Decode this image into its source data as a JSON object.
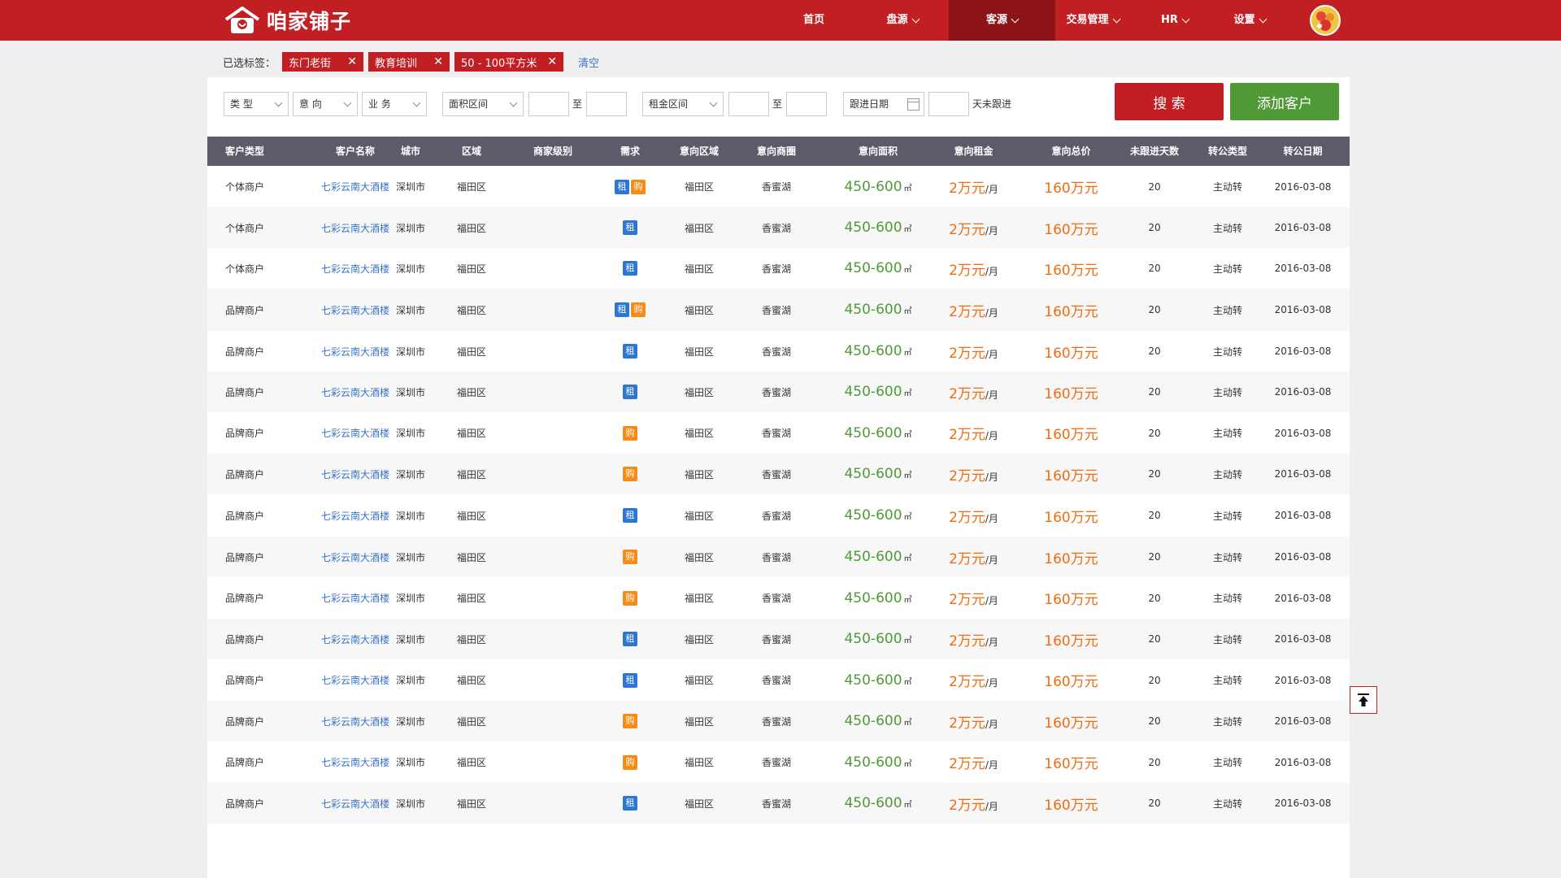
{
  "brand": {
    "name": "咱家铺子"
  },
  "nav": {
    "items": [
      {
        "label": "首页",
        "dropdown": false,
        "active": false
      },
      {
        "label": "盘源",
        "dropdown": true,
        "active": false
      },
      {
        "label": "客源",
        "dropdown": true,
        "active": true
      },
      {
        "label": "交易管理",
        "dropdown": true,
        "active": false
      },
      {
        "label": "HR",
        "dropdown": true,
        "active": false
      },
      {
        "label": "设置",
        "dropdown": true,
        "active": false
      }
    ]
  },
  "tags": {
    "label": "已选标签：",
    "items": [
      "东门老街",
      "教育培训",
      "50 - 100平方米"
    ],
    "clear_label": "清空"
  },
  "filters": {
    "type": "类 型",
    "intent": "意 向",
    "business": "业 务",
    "area_range": "面积区间",
    "to1": "至",
    "rent_range": "租金区间",
    "to2": "至",
    "follow_date": "跟进日期",
    "days_unfollowed": "天未跟进",
    "search_label": "搜 索",
    "add_label": "添加客户"
  },
  "table": {
    "columns": [
      "客户类型",
      "客户名称",
      "城市",
      "区域",
      "商家级别",
      "需求",
      "意向区域",
      "意向商圈",
      "意向面积",
      "意向租金",
      "意向总价",
      "未跟进天数",
      "转公类型",
      "转公日期"
    ],
    "badge_labels": {
      "rent": "租",
      "buy": "购"
    },
    "rows": [
      {
        "type": "个体商户",
        "name": "七彩云南大酒楼",
        "city": "深圳市",
        "district": "福田区",
        "level": "",
        "needs": [
          "rent",
          "buy"
        ],
        "area_intent": "福田区",
        "circle": "香蜜湖",
        "area": "450-600",
        "area_unit": "㎡",
        "rent": "2万元",
        "rent_unit": "/月",
        "price": "160万元",
        "days": "20",
        "transfer_type": "主动转",
        "transfer_date": "2016-03-08"
      },
      {
        "type": "个体商户",
        "name": "七彩云南大酒楼",
        "city": "深圳市",
        "district": "福田区",
        "level": "",
        "needs": [
          "rent"
        ],
        "area_intent": "福田区",
        "circle": "香蜜湖",
        "area": "450-600",
        "area_unit": "㎡",
        "rent": "2万元",
        "rent_unit": "/月",
        "price": "160万元",
        "days": "20",
        "transfer_type": "主动转",
        "transfer_date": "2016-03-08"
      },
      {
        "type": "个体商户",
        "name": "七彩云南大酒楼",
        "city": "深圳市",
        "district": "福田区",
        "level": "",
        "needs": [
          "rent"
        ],
        "area_intent": "福田区",
        "circle": "香蜜湖",
        "area": "450-600",
        "area_unit": "㎡",
        "rent": "2万元",
        "rent_unit": "/月",
        "price": "160万元",
        "days": "20",
        "transfer_type": "主动转",
        "transfer_date": "2016-03-08"
      },
      {
        "type": "品牌商户",
        "name": "七彩云南大酒楼",
        "city": "深圳市",
        "district": "福田区",
        "level": "",
        "needs": [
          "rent",
          "buy"
        ],
        "area_intent": "福田区",
        "circle": "香蜜湖",
        "area": "450-600",
        "area_unit": "㎡",
        "rent": "2万元",
        "rent_unit": "/月",
        "price": "160万元",
        "days": "20",
        "transfer_type": "主动转",
        "transfer_date": "2016-03-08"
      },
      {
        "type": "品牌商户",
        "name": "七彩云南大酒楼",
        "city": "深圳市",
        "district": "福田区",
        "level": "",
        "needs": [
          "rent"
        ],
        "area_intent": "福田区",
        "circle": "香蜜湖",
        "area": "450-600",
        "area_unit": "㎡",
        "rent": "2万元",
        "rent_unit": "/月",
        "price": "160万元",
        "days": "20",
        "transfer_type": "主动转",
        "transfer_date": "2016-03-08"
      },
      {
        "type": "品牌商户",
        "name": "七彩云南大酒楼",
        "city": "深圳市",
        "district": "福田区",
        "level": "",
        "needs": [
          "rent"
        ],
        "area_intent": "福田区",
        "circle": "香蜜湖",
        "area": "450-600",
        "area_unit": "㎡",
        "rent": "2万元",
        "rent_unit": "/月",
        "price": "160万元",
        "days": "20",
        "transfer_type": "主动转",
        "transfer_date": "2016-03-08"
      },
      {
        "type": "品牌商户",
        "name": "七彩云南大酒楼",
        "city": "深圳市",
        "district": "福田区",
        "level": "",
        "needs": [
          "buy"
        ],
        "area_intent": "福田区",
        "circle": "香蜜湖",
        "area": "450-600",
        "area_unit": "㎡",
        "rent": "2万元",
        "rent_unit": "/月",
        "price": "160万元",
        "days": "20",
        "transfer_type": "主动转",
        "transfer_date": "2016-03-08"
      },
      {
        "type": "品牌商户",
        "name": "七彩云南大酒楼",
        "city": "深圳市",
        "district": "福田区",
        "level": "",
        "needs": [
          "buy"
        ],
        "area_intent": "福田区",
        "circle": "香蜜湖",
        "area": "450-600",
        "area_unit": "㎡",
        "rent": "2万元",
        "rent_unit": "/月",
        "price": "160万元",
        "days": "20",
        "transfer_type": "主动转",
        "transfer_date": "2016-03-08"
      },
      {
        "type": "品牌商户",
        "name": "七彩云南大酒楼",
        "city": "深圳市",
        "district": "福田区",
        "level": "",
        "needs": [
          "rent"
        ],
        "area_intent": "福田区",
        "circle": "香蜜湖",
        "area": "450-600",
        "area_unit": "㎡",
        "rent": "2万元",
        "rent_unit": "/月",
        "price": "160万元",
        "days": "20",
        "transfer_type": "主动转",
        "transfer_date": "2016-03-08"
      },
      {
        "type": "品牌商户",
        "name": "七彩云南大酒楼",
        "city": "深圳市",
        "district": "福田区",
        "level": "",
        "needs": [
          "buy"
        ],
        "area_intent": "福田区",
        "circle": "香蜜湖",
        "area": "450-600",
        "area_unit": "㎡",
        "rent": "2万元",
        "rent_unit": "/月",
        "price": "160万元",
        "days": "20",
        "transfer_type": "主动转",
        "transfer_date": "2016-03-08"
      },
      {
        "type": "品牌商户",
        "name": "七彩云南大酒楼",
        "city": "深圳市",
        "district": "福田区",
        "level": "",
        "needs": [
          "buy"
        ],
        "area_intent": "福田区",
        "circle": "香蜜湖",
        "area": "450-600",
        "area_unit": "㎡",
        "rent": "2万元",
        "rent_unit": "/月",
        "price": "160万元",
        "days": "20",
        "transfer_type": "主动转",
        "transfer_date": "2016-03-08"
      },
      {
        "type": "品牌商户",
        "name": "七彩云南大酒楼",
        "city": "深圳市",
        "district": "福田区",
        "level": "",
        "needs": [
          "rent"
        ],
        "area_intent": "福田区",
        "circle": "香蜜湖",
        "area": "450-600",
        "area_unit": "㎡",
        "rent": "2万元",
        "rent_unit": "/月",
        "price": "160万元",
        "days": "20",
        "transfer_type": "主动转",
        "transfer_date": "2016-03-08"
      },
      {
        "type": "品牌商户",
        "name": "七彩云南大酒楼",
        "city": "深圳市",
        "district": "福田区",
        "level": "",
        "needs": [
          "rent"
        ],
        "area_intent": "福田区",
        "circle": "香蜜湖",
        "area": "450-600",
        "area_unit": "㎡",
        "rent": "2万元",
        "rent_unit": "/月",
        "price": "160万元",
        "days": "20",
        "transfer_type": "主动转",
        "transfer_date": "2016-03-08"
      },
      {
        "type": "品牌商户",
        "name": "七彩云南大酒楼",
        "city": "深圳市",
        "district": "福田区",
        "level": "",
        "needs": [
          "buy"
        ],
        "area_intent": "福田区",
        "circle": "香蜜湖",
        "area": "450-600",
        "area_unit": "㎡",
        "rent": "2万元",
        "rent_unit": "/月",
        "price": "160万元",
        "days": "20",
        "transfer_type": "主动转",
        "transfer_date": "2016-03-08"
      },
      {
        "type": "品牌商户",
        "name": "七彩云南大酒楼",
        "city": "深圳市",
        "district": "福田区",
        "level": "",
        "needs": [
          "buy"
        ],
        "area_intent": "福田区",
        "circle": "香蜜湖",
        "area": "450-600",
        "area_unit": "㎡",
        "rent": "2万元",
        "rent_unit": "/月",
        "price": "160万元",
        "days": "20",
        "transfer_type": "主动转",
        "transfer_date": "2016-03-08"
      },
      {
        "type": "品牌商户",
        "name": "七彩云南大酒楼",
        "city": "深圳市",
        "district": "福田区",
        "level": "",
        "needs": [
          "rent"
        ],
        "area_intent": "福田区",
        "circle": "香蜜湖",
        "area": "450-600",
        "area_unit": "㎡",
        "rent": "2万元",
        "rent_unit": "/月",
        "price": "160万元",
        "days": "20",
        "transfer_type": "主动转",
        "transfer_date": "2016-03-08"
      }
    ]
  },
  "colors": {
    "brand_red": "#c21f24",
    "active_nav": "#8c1416",
    "add_green": "#4f9a36",
    "header_gray": "#5b5b6a",
    "link_blue": "#3a73c8",
    "price_orange": "#f26b0f",
    "area_green": "#4f9a36"
  }
}
